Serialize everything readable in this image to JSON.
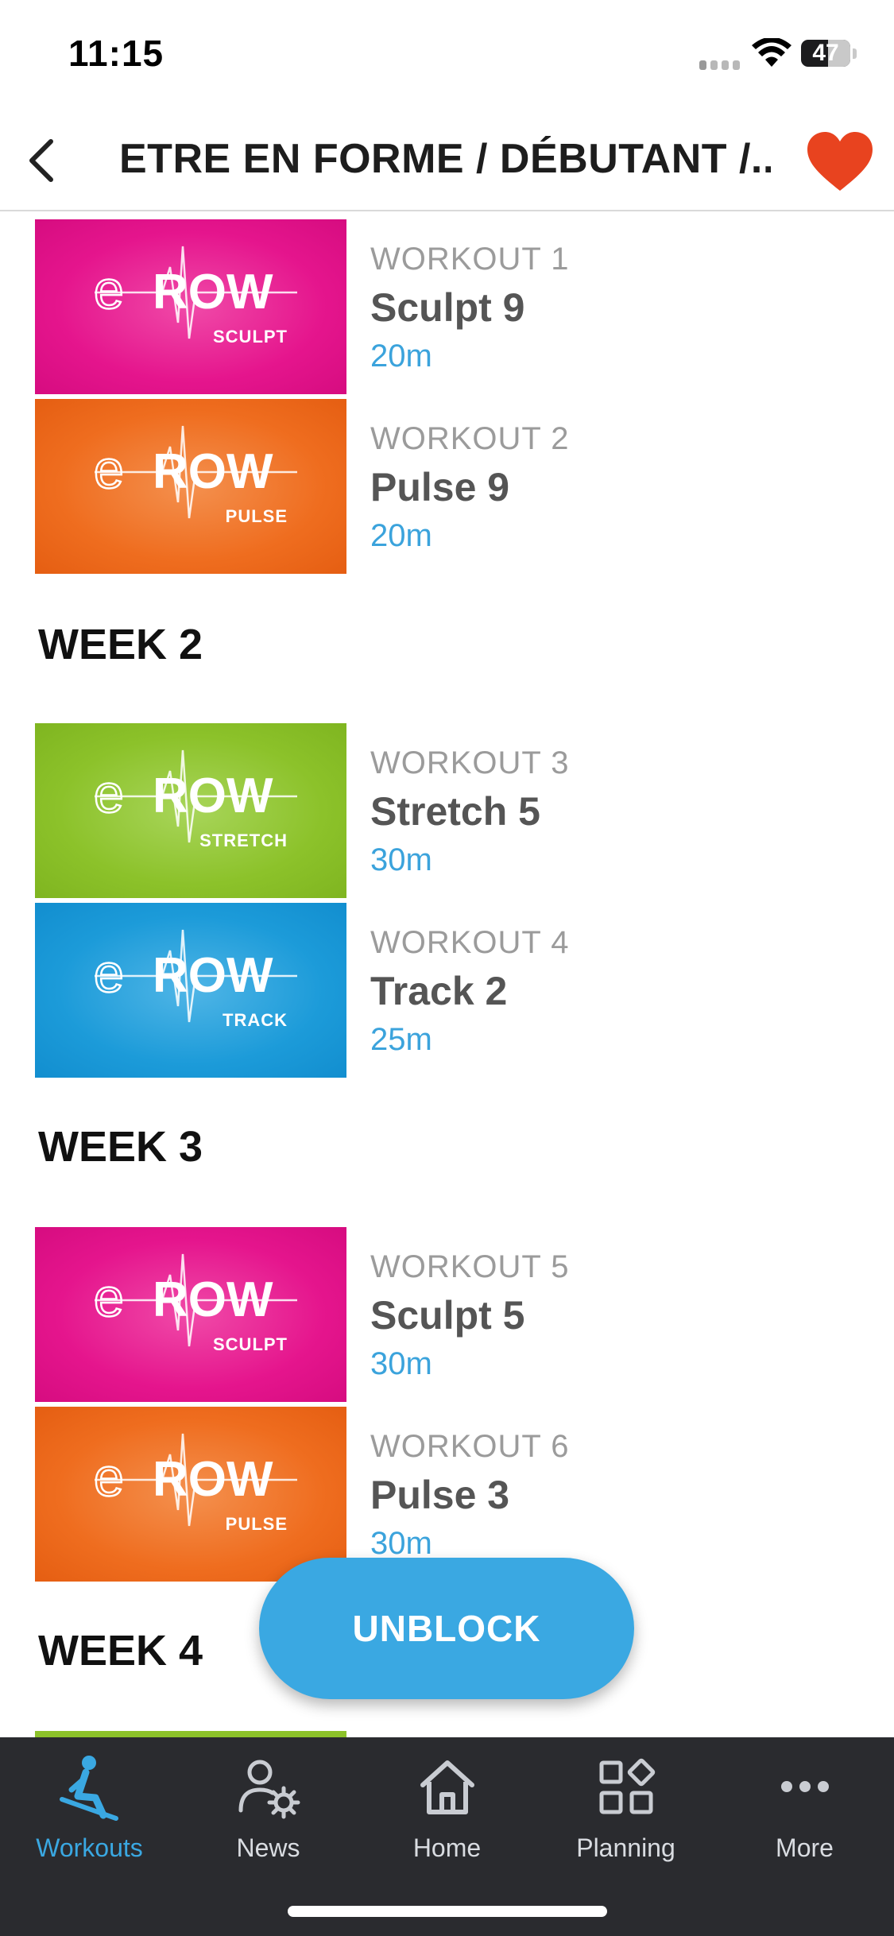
{
  "status_bar": {
    "time": "11:15",
    "battery": "47"
  },
  "header": {
    "title": "ETRE EN FORME / DÉBUTANT /..."
  },
  "colors": {
    "sculpt": "#e5158d",
    "pulse": "#ef6d1f",
    "stretch": "#8cc22a",
    "track": "#1c9bd9",
    "accent": "#3aa8e2",
    "favorite": "#e8431f",
    "tabbar": "#2a2b2f"
  },
  "brand": "eROW",
  "workouts": [
    {
      "number": "WORKOUT 1",
      "name": "Sculpt 9",
      "duration": "20m",
      "type": "SCULPT"
    },
    {
      "number": "WORKOUT 2",
      "name": "Pulse 9",
      "duration": "20m",
      "type": "PULSE"
    },
    {
      "number": "WORKOUT 3",
      "name": "Stretch 5",
      "duration": "30m",
      "type": "STRETCH"
    },
    {
      "number": "WORKOUT 4",
      "name": "Track 2",
      "duration": "25m",
      "type": "TRACK"
    },
    {
      "number": "WORKOUT 5",
      "name": "Sculpt 5",
      "duration": "30m",
      "type": "SCULPT"
    },
    {
      "number": "WORKOUT 6",
      "name": "Pulse 3",
      "duration": "30m",
      "type": "PULSE"
    }
  ],
  "weeks": [
    "WEEK 2",
    "WEEK 3",
    "WEEK 4"
  ],
  "unblock_label": "UNBLOCK",
  "tabs": [
    {
      "label": "Workouts",
      "icon": "rower-icon",
      "active": true
    },
    {
      "label": "News",
      "icon": "news-user-gear-icon",
      "active": false
    },
    {
      "label": "Home",
      "icon": "home-icon",
      "active": false
    },
    {
      "label": "Planning",
      "icon": "grid-icon",
      "active": false
    },
    {
      "label": "More",
      "icon": "more-dots-icon",
      "active": false
    }
  ]
}
